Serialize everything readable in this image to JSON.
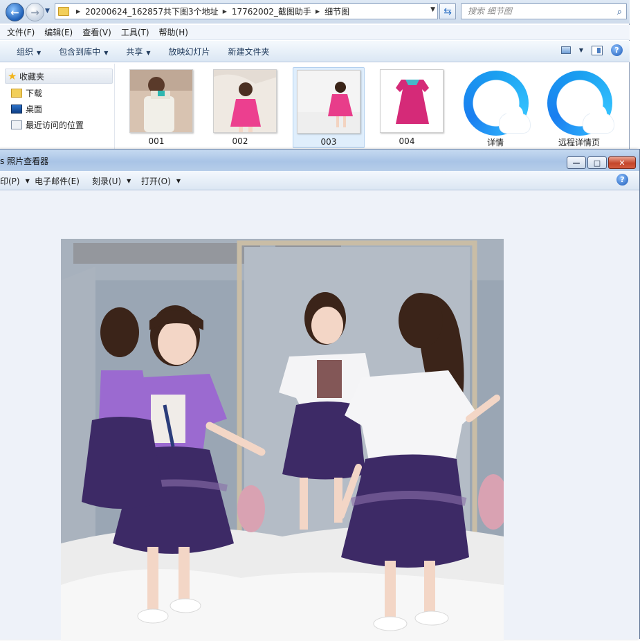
{
  "explorer": {
    "address": {
      "crumbs": [
        "20200624_162857共下图3个地址",
        "17762002_截图助手",
        "细节图"
      ]
    },
    "search_placeholder": "搜索 细节图",
    "menu": [
      "文件(F)",
      "编辑(E)",
      "查看(V)",
      "工具(T)",
      "帮助(H)"
    ],
    "commands": [
      "组织",
      "包含到库中",
      "共享",
      "放映幻灯片",
      "新建文件夹"
    ],
    "favorites": {
      "header": "收藏夹",
      "items": [
        "下载",
        "桌面",
        "最近访问的位置"
      ]
    },
    "files": [
      {
        "name": "001",
        "selected": false
      },
      {
        "name": "002",
        "selected": false
      },
      {
        "name": "003",
        "selected": true
      },
      {
        "name": "004",
        "selected": false
      },
      {
        "name": "详情",
        "icon": "qq-browser-icon"
      },
      {
        "name": "远程详情页",
        "icon": "qq-browser-icon"
      }
    ]
  },
  "viewer": {
    "title": "s 照片查看器",
    "toolbar": [
      "印(P)",
      "电子邮件(E)",
      "刻录(U)",
      "打开(O)"
    ],
    "photo": {
      "icon": "photo-two-girls-mirror",
      "skirt_color": "#3d2a66",
      "shirt_color": "#9b6ad0"
    }
  },
  "colors": {
    "titlebar": "#a9c4e6",
    "close": "#c4452a",
    "selection": "#dfeefc"
  }
}
